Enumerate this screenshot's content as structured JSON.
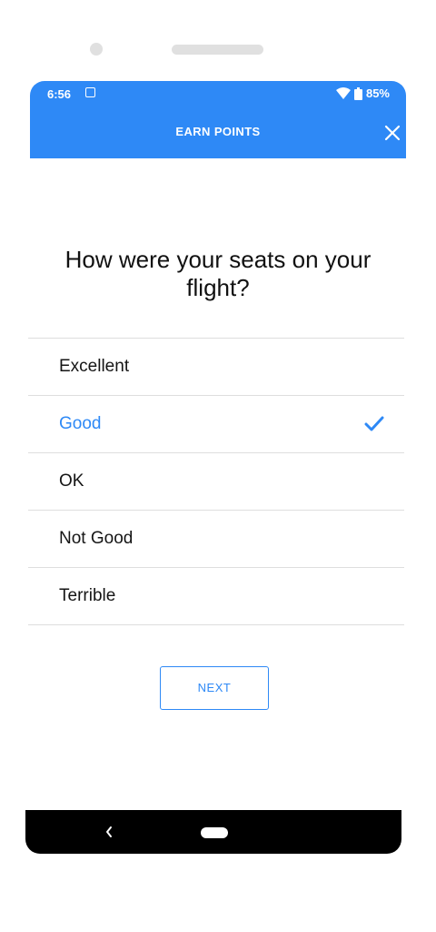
{
  "status_bar": {
    "time": "6:56",
    "battery": "85%",
    "icons": [
      "gallery-icon",
      "wifi-icon",
      "battery-icon"
    ]
  },
  "app_bar": {
    "title": "EARN POINTS",
    "close_icon": "close-icon"
  },
  "question": "How were your seats on your flight?",
  "options": [
    {
      "label": "Excellent",
      "selected": false
    },
    {
      "label": "Good",
      "selected": true
    },
    {
      "label": "OK",
      "selected": false
    },
    {
      "label": "Not Good",
      "selected": false
    },
    {
      "label": "Terrible",
      "selected": false
    }
  ],
  "next_button": "NEXT",
  "colors": {
    "accent": "#2e89f6",
    "text": "#151515",
    "divider": "#dedede"
  }
}
